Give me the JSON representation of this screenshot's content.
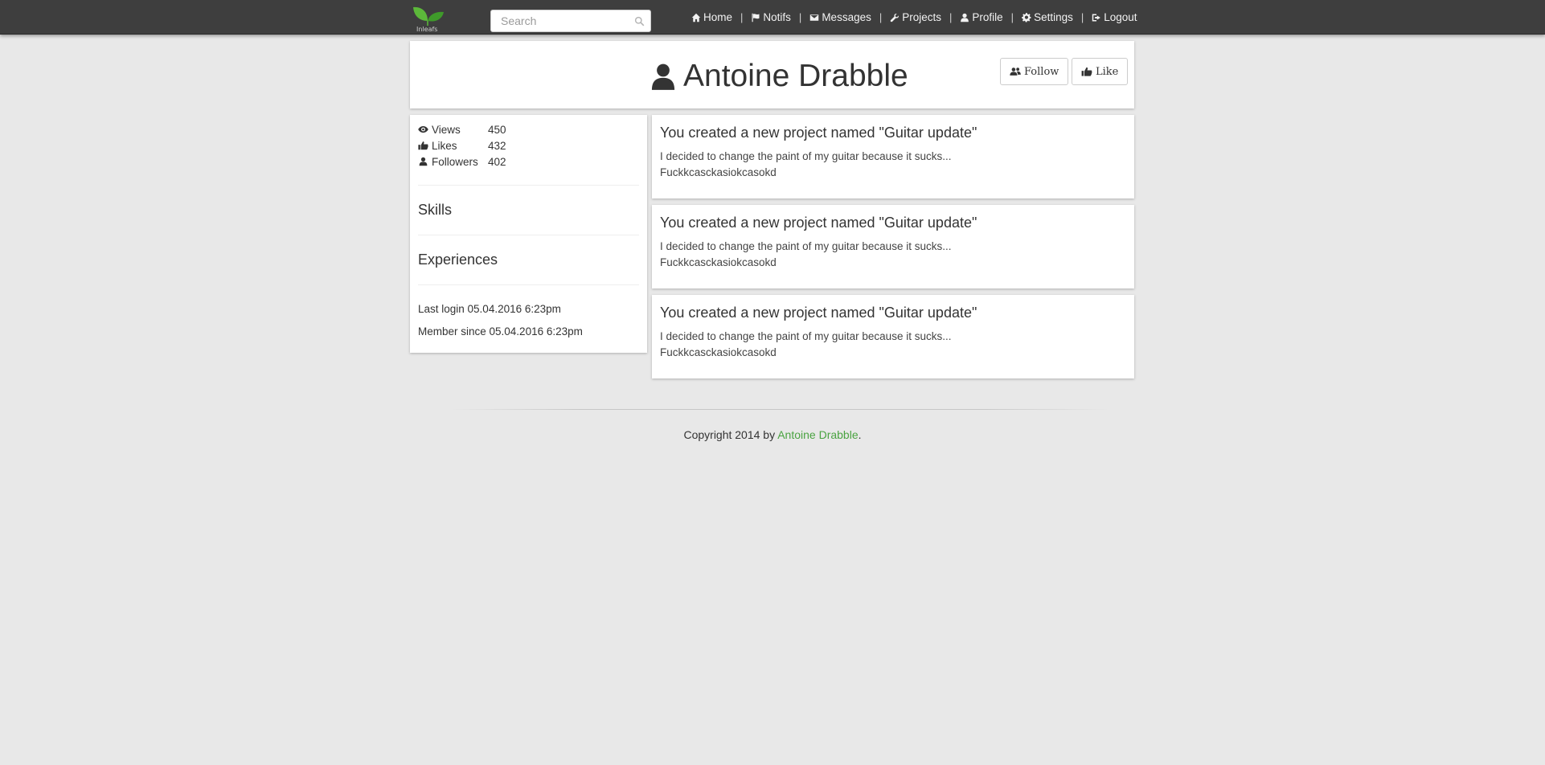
{
  "nav": {
    "logo_text": "Inleafs",
    "search_placeholder": "Search",
    "links": [
      {
        "label": "Home",
        "icon": "home-icon"
      },
      {
        "label": "Notifs",
        "icon": "flag-icon"
      },
      {
        "label": "Messages",
        "icon": "envelope-icon"
      },
      {
        "label": "Projects",
        "icon": "wrench-icon"
      },
      {
        "label": "Profile",
        "icon": "user-icon"
      },
      {
        "label": "Settings",
        "icon": "gear-icon"
      },
      {
        "label": "Logout",
        "icon": "sign-out-icon"
      }
    ],
    "separator": "|"
  },
  "profile": {
    "name": "Antoine Drabble",
    "follow_label": "Follow",
    "like_label": "Like"
  },
  "sidebar": {
    "stats": [
      {
        "label": "Views",
        "value": "450",
        "icon": "eye-icon"
      },
      {
        "label": "Likes",
        "value": "432",
        "icon": "thumbs-up-icon"
      },
      {
        "label": "Followers",
        "value": "402",
        "icon": "user-icon"
      }
    ],
    "skills_title": "Skills",
    "experiences_title": "Experiences",
    "last_login": "Last login 05.04.2016 6:23pm",
    "member_since": "Member since 05.04.2016 6:23pm"
  },
  "feed": [
    {
      "title": "You created a new project named \"Guitar update\"",
      "line1": "I decided to change the paint of my guitar because it sucks...",
      "line2": "Fuckkcasckasiokcasokd"
    },
    {
      "title": "You created a new project named \"Guitar update\"",
      "line1": "I decided to change the paint of my guitar because it sucks...",
      "line2": "Fuckkcasckasiokcasokd"
    },
    {
      "title": "You created a new project named \"Guitar update\"",
      "line1": "I decided to change the paint of my guitar because it sucks...",
      "line2": "Fuckkcasckasiokcasokd"
    }
  ],
  "footer": {
    "prefix": "Copyright 2014 by ",
    "author": "Antoine Drabble",
    "suffix": "."
  },
  "colors": {
    "navbar": "#3e3e3e",
    "background": "#e8e8e8",
    "accent_green": "#4aa341"
  }
}
